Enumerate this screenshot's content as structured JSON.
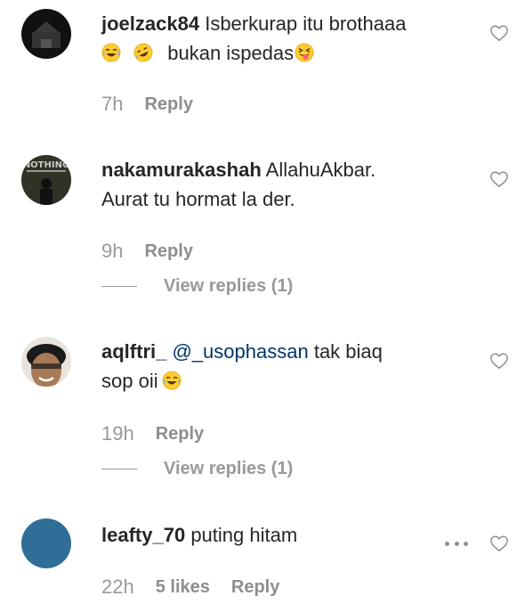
{
  "comments": [
    {
      "username": "joelzack84",
      "text_line1": "Isberkurap itu brothaaa",
      "text_line2": "bukan ispedas",
      "time": "7h",
      "reply_label": "Reply"
    },
    {
      "username": "nakamurakashah",
      "text_line1": "AllahuAkbar.",
      "text_line2": "Aurat tu hormat la der.",
      "avatar_text": "NOTHING",
      "time": "9h",
      "reply_label": "Reply",
      "view_replies": "View replies (1)"
    },
    {
      "username": "aqlftri_",
      "mention": "@_usophassan",
      "text_line1": "tak biaq",
      "text_line2": "sop oii",
      "time": "19h",
      "reply_label": "Reply",
      "view_replies": "View replies (1)"
    },
    {
      "username": "leafty_70",
      "text_line1": "puting hitam",
      "time": "22h",
      "likes": "5 likes",
      "reply_label": "Reply",
      "avatar_color": "#2f6e96"
    }
  ],
  "icons": {
    "like": "heart-outline-icon",
    "more": "more-options-icon",
    "emoji_joy": "face-with-tears-of-joy",
    "emoji_rofl": "rolling-on-floor-laughing",
    "emoji_tongue": "squinting-face-with-tongue"
  },
  "colors": {
    "mention": "#003569",
    "meta": "#8e8e8e"
  }
}
